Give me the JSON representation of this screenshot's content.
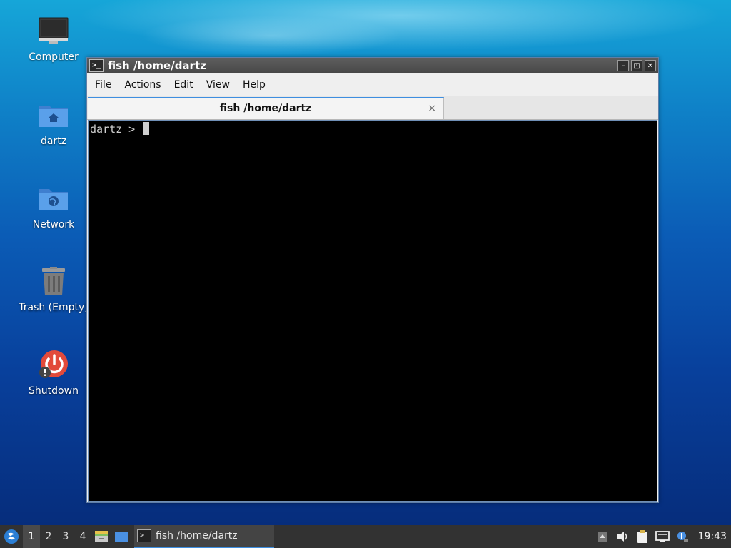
{
  "desktop": {
    "icons": [
      {
        "label": "Computer",
        "icon": "computer-icon"
      },
      {
        "label": "dartz",
        "icon": "home-folder-icon"
      },
      {
        "label": "Network",
        "icon": "network-folder-icon"
      },
      {
        "label": "Trash (Empty)",
        "icon": "trash-icon"
      },
      {
        "label": "Shutdown",
        "icon": "shutdown-icon"
      }
    ]
  },
  "window": {
    "title": "fish /home/dartz",
    "menu": [
      "File",
      "Actions",
      "Edit",
      "View",
      "Help"
    ],
    "tab_label": "fish /home/dartz",
    "tab_close": "×",
    "terminal": {
      "prompt": "dartz > "
    },
    "colors": {
      "accent": "#3d8ee0",
      "terminal_bg": "#000000"
    }
  },
  "taskbar": {
    "workspaces": [
      "1",
      "2",
      "3",
      "4"
    ],
    "active_workspace": "1",
    "task_label": "fish /home/dartz",
    "clock": "19:43"
  }
}
